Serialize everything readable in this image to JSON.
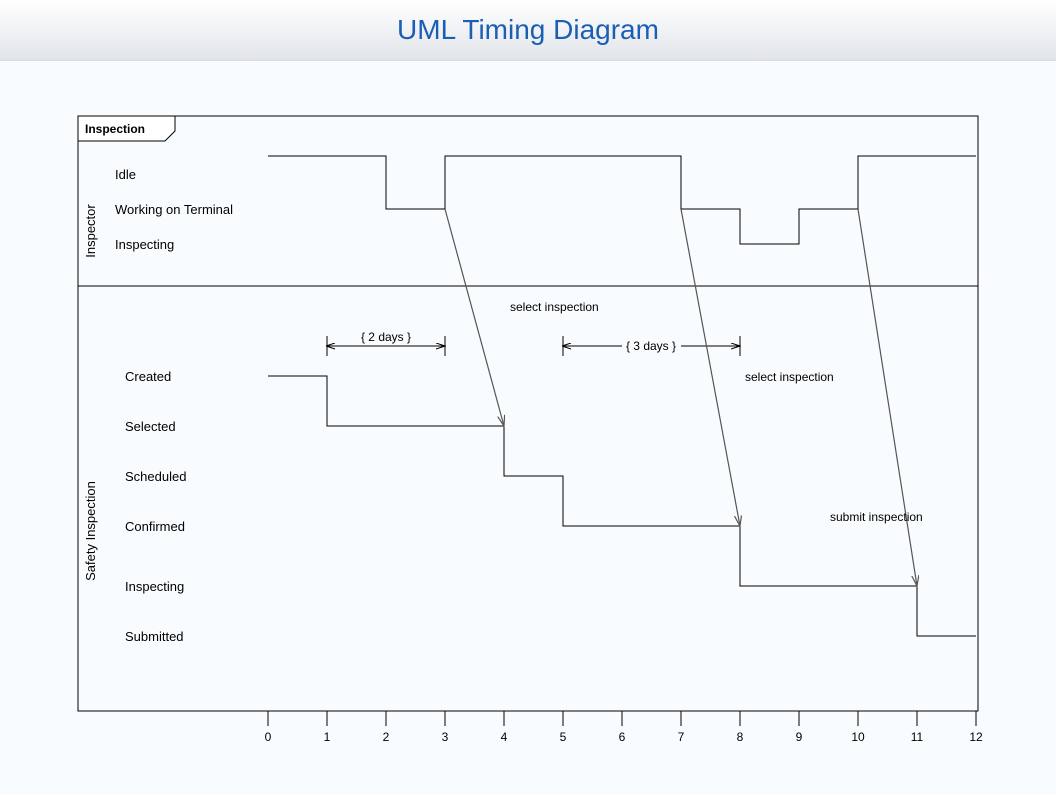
{
  "title": "UML Timing Diagram",
  "frame_label": "Inspection",
  "lifelines": {
    "inspector": {
      "name": "Inspector",
      "states": [
        "Idle",
        "Working on Terminal",
        "Inspecting"
      ]
    },
    "safety": {
      "name": "Safety Inspection",
      "states": [
        "Created",
        "Selected",
        "Scheduled",
        "Confirmed",
        "Inspecting",
        "Submitted"
      ]
    }
  },
  "axis": {
    "ticks": [
      "0",
      "1",
      "2",
      "3",
      "4",
      "5",
      "6",
      "7",
      "8",
      "9",
      "10",
      "11",
      "12"
    ]
  },
  "annotations": {
    "duration1": "{ 2 days }",
    "duration2": "{ 3 days }"
  },
  "messages": {
    "m1": "select inspection",
    "m2": "select inspection",
    "m3": "submit inspection"
  },
  "chart_data": {
    "type": "timing",
    "time_range": [
      0,
      12
    ],
    "lifelines": [
      {
        "name": "Inspector",
        "states_order": [
          "Idle",
          "Working on Terminal",
          "Inspecting"
        ],
        "segments": [
          {
            "from": 0,
            "to": 2,
            "state": "Idle"
          },
          {
            "from": 2,
            "to": 3,
            "state": "Working on Terminal"
          },
          {
            "from": 3,
            "to": 7,
            "state": "Idle"
          },
          {
            "from": 7,
            "to": 8,
            "state": "Working on Terminal"
          },
          {
            "from": 8,
            "to": 9,
            "state": "Inspecting"
          },
          {
            "from": 9,
            "to": 10,
            "state": "Working on Terminal"
          },
          {
            "from": 10,
            "to": 12,
            "state": "Idle"
          }
        ]
      },
      {
        "name": "Safety Inspection",
        "states_order": [
          "Created",
          "Selected",
          "Scheduled",
          "Confirmed",
          "Inspecting",
          "Submitted"
        ],
        "segments": [
          {
            "from": 0,
            "to": 1,
            "state": "Created"
          },
          {
            "from": 1,
            "to": 4,
            "state": "Selected"
          },
          {
            "from": 4,
            "to": 5,
            "state": "Scheduled"
          },
          {
            "from": 5,
            "to": 8,
            "state": "Confirmed"
          },
          {
            "from": 8,
            "to": 11,
            "state": "Inspecting"
          },
          {
            "from": 11,
            "to": 12,
            "state": "Submitted"
          }
        ]
      }
    ],
    "duration_constraints": [
      {
        "label": "{ 2 days }",
        "from": 1,
        "to": 3
      },
      {
        "label": "{ 3 days }",
        "from": 5,
        "to": 8
      }
    ],
    "messages": [
      {
        "label": "select inspection",
        "from_lifeline": "Inspector",
        "from_time": 3,
        "to_lifeline": "Safety Inspection",
        "to_time": 4,
        "to_state": "Scheduled"
      },
      {
        "label": "select inspection",
        "from_lifeline": "Inspector",
        "from_time": 7,
        "to_lifeline": "Safety Inspection",
        "to_time": 8,
        "to_state": "Inspecting"
      },
      {
        "label": "submit inspection",
        "from_lifeline": "Inspector",
        "from_time": 10,
        "to_lifeline": "Safety Inspection",
        "to_time": 11,
        "to_state": "Submitted"
      }
    ]
  }
}
